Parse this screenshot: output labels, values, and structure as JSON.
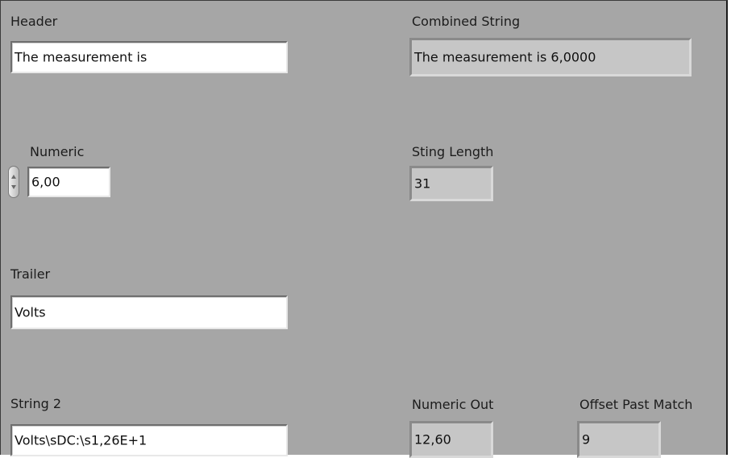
{
  "header": {
    "label": "Header",
    "value": "The measurement is"
  },
  "combined_string": {
    "label": "Combined String",
    "value": "The measurement is 6,0000"
  },
  "numeric": {
    "label": "Numeric",
    "value": "6,00"
  },
  "string_length": {
    "label": "Sting Length",
    "value": "31"
  },
  "trailer": {
    "label": "Trailer",
    "value": "Volts"
  },
  "string2": {
    "label": "String 2",
    "value": "Volts\\sDC:\\s1,26E+1"
  },
  "numeric_out": {
    "label": "Numeric Out",
    "value": "12,60"
  },
  "offset_past_match": {
    "label": "Offset Past Match",
    "value": "9"
  },
  "icons": {
    "spinner": "increment-decrement-icon"
  }
}
